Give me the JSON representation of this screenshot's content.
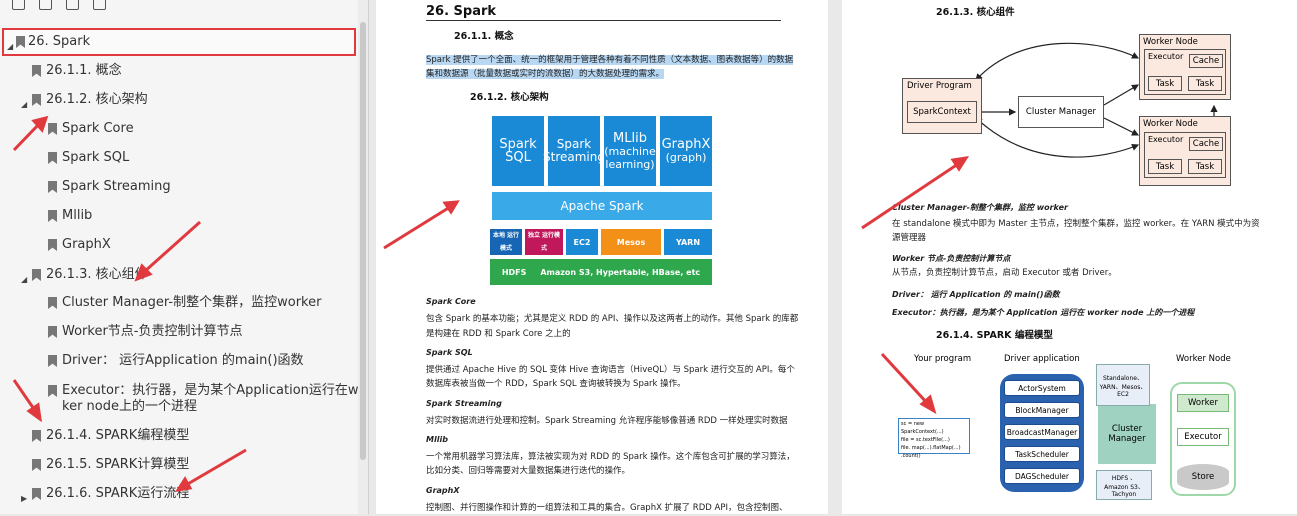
{
  "sidebar": {
    "toolbar_icons": [
      "expand-all-icon",
      "collapse-all-icon",
      "add-bookmark-icon",
      "bookmark-icon"
    ],
    "items": [
      {
        "label": "26. Spark",
        "level": 0,
        "arrow": "down",
        "selected": true
      },
      {
        "label": "26.1.1. 概念",
        "level": 1,
        "arrow": ""
      },
      {
        "label": "26.1.2. 核心架构",
        "level": 1,
        "arrow": "down"
      },
      {
        "label": "Spark Core",
        "level": 2,
        "arrow": ""
      },
      {
        "label": "Spark SQL",
        "level": 2,
        "arrow": ""
      },
      {
        "label": "Spark Streaming",
        "level": 2,
        "arrow": ""
      },
      {
        "label": "Mllib",
        "level": 2,
        "arrow": ""
      },
      {
        "label": "GraphX",
        "level": 2,
        "arrow": ""
      },
      {
        "label": "26.1.3. 核心组件",
        "level": 1,
        "arrow": "down"
      },
      {
        "label": "Cluster Manager-制整个集群，监控worker",
        "level": 2,
        "arrow": ""
      },
      {
        "label": "Worker节点-负责控制计算节点",
        "level": 2,
        "arrow": ""
      },
      {
        "label": "Driver： 运行Application 的main()函数",
        "level": 2,
        "arrow": ""
      },
      {
        "label": "Executor：执行器，是为某个Application运行在wor",
        "label2": "ker node上的一个进程",
        "level": 2,
        "arrow": ""
      },
      {
        "label": "26.1.4. SPARK编程模型",
        "level": 1,
        "arrow": ""
      },
      {
        "label": "26.1.5. SPARK计算模型",
        "level": 1,
        "arrow": ""
      },
      {
        "label": "26.1.6. SPARK运行流程",
        "level": 1,
        "arrow": "right"
      }
    ]
  },
  "page_left": {
    "title": "26.  Spark",
    "sec1_title": "26.1.1.      概念",
    "sec1_text_1": "Spark 提供了一个全面、统一的框架用于管理各种有着不同性质（文本数据、图表数据等）的数据",
    "sec1_text_2": "集和数据源（批量数据或实时的流数据）的大数据处理的需求。",
    "sec2_title": "26.1.2.      核心架构",
    "stack": {
      "top": [
        "Spark SQL",
        "Spark Streaming",
        "MLlib (machine learning)",
        "GraphX (graph)"
      ],
      "core": "Apache Spark",
      "managers": [
        "本地 运行模式",
        "独立 运行模式",
        "EC2",
        "Mesos",
        "YARN"
      ],
      "storage": "HDFS     Amazon S3, Hypertable, HBase, etc",
      "colors": {
        "top": "#1b8ad6",
        "core": "#3aa9e8",
        "local": "#1766b5",
        "standalone": "#c0185a",
        "ec2": "#1b8ad6",
        "mesos": "#f39018",
        "yarn": "#1b8ad6",
        "storage": "#2fa84d"
      }
    },
    "core_title": "Spark Core",
    "core_text_1": "包含 Spark 的基本功能；尤其是定义 RDD 的 API、操作以及这两者上的动作。其他 Spark 的库都",
    "core_text_2": "是构建在 RDD 和 Spark Core 之上的",
    "sql_title": "Spark SQL",
    "sql_text_1": "提供通过 Apache Hive 的 SQL 变体 Hive 查询语言（HiveQL）与 Spark 进行交互的 API。每个",
    "sql_text_2": "数据库表被当做一个 RDD，Spark SQL 查询被转换为 Spark 操作。",
    "stream_title": "Spark Streaming",
    "stream_text": "对实时数据流进行处理和控制。Spark Streaming 允许程序能够像普通 RDD 一样处理实时数据",
    "mllib_title": "Mllib",
    "mllib_text_1": "一个常用机器学习算法库，算法被实现为对 RDD 的 Spark 操作。这个库包含可扩展的学习算法，",
    "mllib_text_2": "比如分类、回归等需要对大量数据集进行迭代的操作。",
    "graphx_title": "GraphX",
    "graphx_text": "控制图、并行图操作和计算的一组算法和工具的集合。GraphX 扩展了 RDD API，包含控制图、"
  },
  "page_right": {
    "sec3_title": "26.1.3.      核心组件",
    "components": {
      "worker_node": "Worker Node",
      "executor": "Executor",
      "cache": "Cache",
      "task": "Task",
      "driver_program": "Driver Program",
      "spark_context": "SparkContext",
      "cluster_manager": "Cluster Manager"
    },
    "cm_title": "Cluster Manager-制整个集群，监控 worker",
    "cm_text_1": "在 standalone 模式中即为 Master 主节点，控制整个集群，监控 worker。在 YARN 模式中为资",
    "cm_text_2": "源管理器",
    "worker_title": "Worker 节点-负责控制计算节点",
    "worker_text": "从节点，负责控制计算节点，启动 Executor 或者 Driver。",
    "driver_title": "Driver： 运行 Application 的 main()函数",
    "executor_title": "Executor：执行器，是为某个 Application 运行在 worker node 上的一个进程",
    "sec4_title": "26.1.4.      SPARK 编程模型",
    "model": {
      "your_program": "Your program",
      "driver_application": "Driver application",
      "worker_node": "Worker Node",
      "code": [
        "sc = new SparkContext(...)",
        "file = sc.textFile(...)",
        "file. map(...).flatMap(...)",
        ".count()"
      ],
      "driver_parts": [
        "ActorSystem",
        "BlockManager",
        "BroadcastManager",
        "TaskScheduler",
        "DAGScheduler"
      ],
      "cluster_manager": "Cluster Manager",
      "cm_note": "Standalone、YARN、Mesos、EC2",
      "worker": "Worker",
      "executor": "Executor",
      "store": "Store",
      "store_note": "HDFS 、 Amazon S3、Tachyon"
    }
  }
}
